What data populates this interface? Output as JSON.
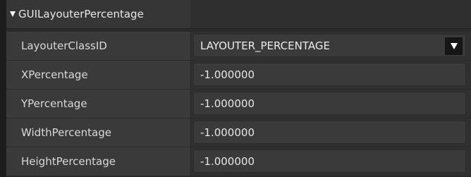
{
  "header": {
    "title": "GUILayouterPercentage",
    "icon": "collapse-triangle-icon"
  },
  "properties": [
    {
      "label": "LayouterClassID",
      "value": "LAYOUTER_PERCENTAGE",
      "type": "dropdown"
    },
    {
      "label": "XPercentage",
      "value": "-1.000000",
      "type": "text"
    },
    {
      "label": "YPercentage",
      "value": "-1.000000",
      "type": "text"
    },
    {
      "label": "WidthPercentage",
      "value": "-1.000000",
      "type": "text"
    },
    {
      "label": "HeightPercentage",
      "value": "-1.000000",
      "type": "text"
    }
  ],
  "colors": {
    "background": "#2a2a2a",
    "label_cell": "#3a3a3a",
    "dropdown_button": "#161616",
    "text": "#dcdcdc"
  }
}
